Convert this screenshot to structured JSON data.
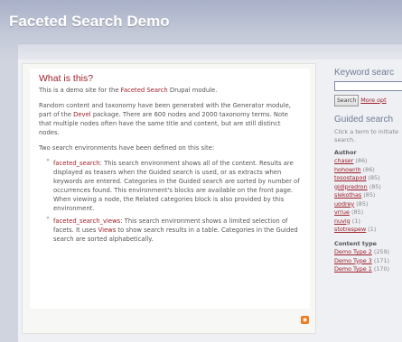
{
  "header": {
    "site_name": "Faceted Search Demo"
  },
  "main": {
    "heading": "What is this?",
    "intro": {
      "before": "This is a demo site for the ",
      "link": "Faceted Search",
      "after": " Drupal module."
    },
    "random": {
      "before": "Random content and taxonomy have been generated with the Generator module, part of the ",
      "link": "Devel",
      "after": " package. There are 600 nodes and 2000 taxonomy terms. Note that multiple nodes often have the same title and content, but are still distinct nodes."
    },
    "environments_intro": "Two search environments have been defined on this site:",
    "environments": [
      {
        "link": "faceted_search",
        "text": ": This search environment shows all of the content. Results are displayed as teasers when the Guided search is used, or as extracts when keywords are entered. Categories in the Guided search are sorted by number of occurrences found. This environment's blocks are available on the front page. When viewing a node, the Related categories block is also provided by this environment."
      },
      {
        "link": "faceted_search_views",
        "text_before": ": This search environment shows a limited selection of facets. It uses ",
        "views_link": "Views",
        "text_after": " to show search results in a table. Categories in the Guided search are sorted alphabetically."
      }
    ]
  },
  "sidebar": {
    "keyword_title": "Keyword searc",
    "search_button": "Search",
    "more_options": "More opt",
    "guided_title": "Guided search",
    "guided_desc": "Click a term to initiate search.",
    "author": {
      "heading": "Author",
      "items": [
        {
          "name": "chaser",
          "count": "(86)"
        },
        {
          "name": "hohowrih",
          "count": "(86)"
        },
        {
          "name": "tosostapod",
          "count": "(85)"
        },
        {
          "name": "gidipredron",
          "count": "(85)"
        },
        {
          "name": "slekothas",
          "count": "(85)"
        },
        {
          "name": "uodrey",
          "count": "(85)"
        },
        {
          "name": "vrrue",
          "count": "(85)"
        },
        {
          "name": "nuvig",
          "count": "(1)"
        },
        {
          "name": "stotrespew",
          "count": "(1)"
        }
      ]
    },
    "content_type": {
      "heading": "Content type",
      "items": [
        {
          "name": "Demo Type 2",
          "count": "(259)"
        },
        {
          "name": "Demo Type 3",
          "count": "(171)"
        },
        {
          "name": "Demo Type 1",
          "count": "(170)"
        }
      ]
    }
  },
  "colors": {
    "accent": "#a0202a",
    "header": "#a8b0c8"
  },
  "icons": {
    "feed": "rss-feed-icon"
  }
}
